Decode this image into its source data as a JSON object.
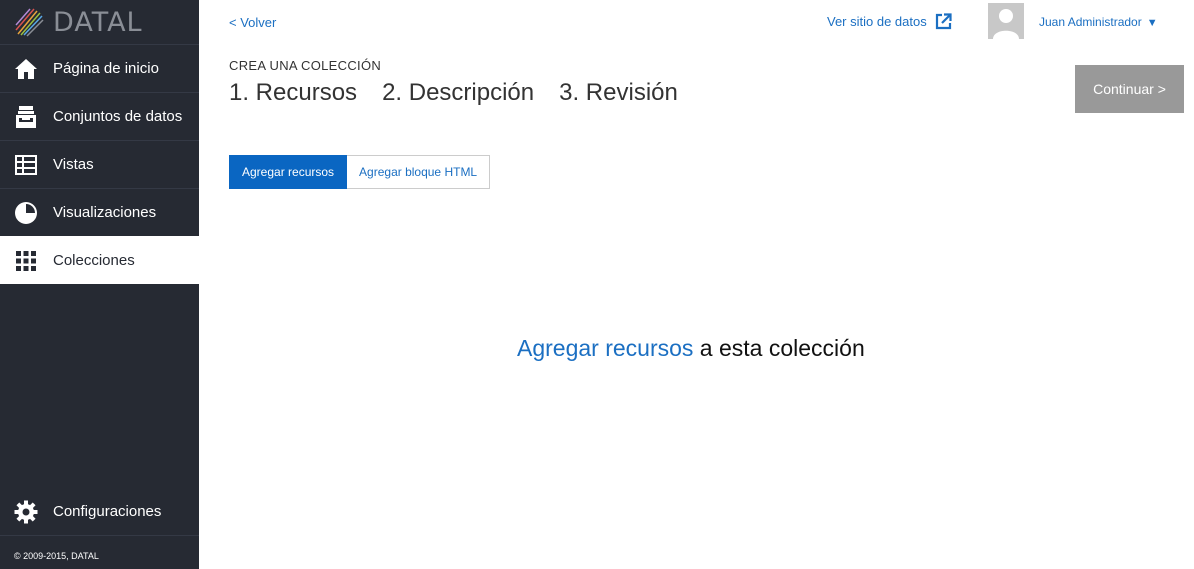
{
  "brand": {
    "name": "DATAL"
  },
  "sidebar": {
    "items": [
      {
        "label": "Página de inicio",
        "icon": "home-icon"
      },
      {
        "label": "Conjuntos de datos",
        "icon": "inbox-icon"
      },
      {
        "label": "Vistas",
        "icon": "table-icon"
      },
      {
        "label": "Visualizaciones",
        "icon": "pie-chart-icon"
      },
      {
        "label": "Colecciones",
        "icon": "grid-icon",
        "active": true
      }
    ],
    "settings_label": "Configuraciones",
    "copyright": "© 2009-2015, DATAL"
  },
  "header": {
    "back_label": "< Volver",
    "data_site_label": "Ver sitio de datos",
    "user_name": "Juan Administrador",
    "user_caret": "▼"
  },
  "wizard": {
    "subtitle": "CREA UNA COLECCIÓN",
    "steps": [
      "1. Recursos",
      "2. Descripción",
      "3. Revisión"
    ],
    "continue_label": "Continuar >"
  },
  "tabs": [
    {
      "label": "Agregar recursos",
      "active": true
    },
    {
      "label": "Agregar bloque HTML",
      "active": false
    }
  ],
  "empty_state": {
    "link_text": "Agregar recursos",
    "rest_text": " a esta colección"
  },
  "colors": {
    "sidebar_bg": "#262a33",
    "link": "#1b6fc2",
    "accent": "#0a66c2",
    "continue_bg": "#999999"
  }
}
